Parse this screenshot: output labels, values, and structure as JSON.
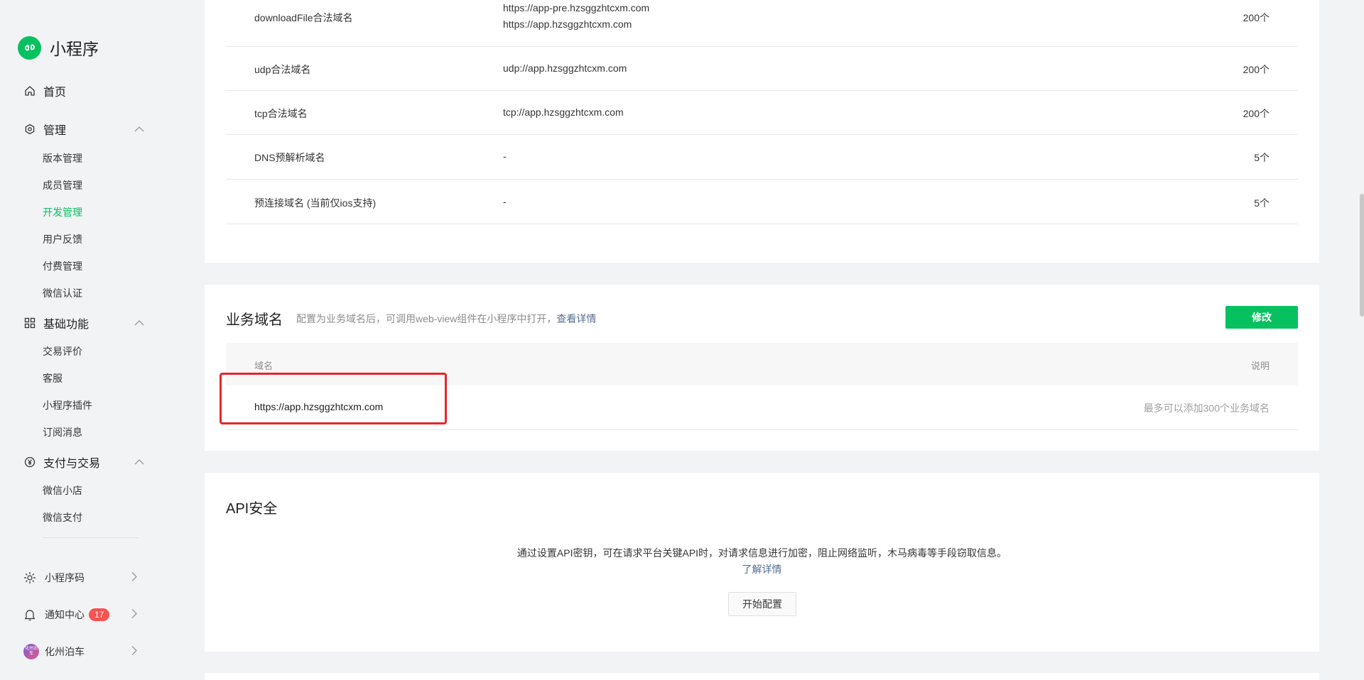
{
  "app": {
    "title": "小程序",
    "brand_color": "#07c160"
  },
  "sidebar": {
    "home": {
      "label": "首页",
      "icon": "home-icon"
    },
    "manage": {
      "label": "管理",
      "icon": "settings-icon",
      "items": [
        "版本管理",
        "成员管理",
        "开发管理",
        "用户反馈",
        "付费管理",
        "微信认证"
      ],
      "active": "开发管理"
    },
    "basic": {
      "label": "基础功能",
      "icon": "apps-icon",
      "items": [
        "交易评价",
        "客服",
        "小程序插件",
        "订阅消息"
      ]
    },
    "pay": {
      "label": "支付与交易",
      "icon": "yen-icon",
      "items": [
        "微信小店",
        "微信支付"
      ]
    },
    "bottom": {
      "qrcode": "小程序码",
      "notify": "通知中心",
      "notify_count": "17",
      "account": "化州泊车",
      "avatar_text": "化州泊车"
    }
  },
  "server_domains": {
    "rows": [
      {
        "name": "downloadFile合法域名",
        "value_1": "https://app-pre.hzsggzhtcxm.com",
        "value_2": "https://app.hzsggzhtcxm.com",
        "limit": "200个"
      },
      {
        "name": "udp合法域名",
        "value": "udp://app.hzsggzhtcxm.com",
        "limit": "200个"
      },
      {
        "name": "tcp合法域名",
        "value": "tcp://app.hzsggzhtcxm.com",
        "limit": "200个"
      },
      {
        "name": "DNS预解析域名",
        "value": "-",
        "limit": "5个"
      },
      {
        "name": "预连接域名 (当前仅ios支持)",
        "value": "-",
        "limit": "5个"
      }
    ]
  },
  "business_domain": {
    "title": "业务域名",
    "desc": "配置为业务域名后，可调用web-view组件在小程序中打开，",
    "desc_link": "查看详情",
    "edit_button": "修改",
    "col_domain": "域名",
    "col_note": "说明",
    "domain": "https://app.hzsggzhtcxm.com",
    "note": "最多可以添加300个业务域名",
    "highlight_color": "#e5262b"
  },
  "api_security": {
    "title": "API安全",
    "desc": "通过设置API密钥，可在请求平台关键API时，对请求信息进行加密，阻止网络监听，木马病毒等手段窃取信息。",
    "link": "了解详情",
    "button": "开始配置"
  }
}
